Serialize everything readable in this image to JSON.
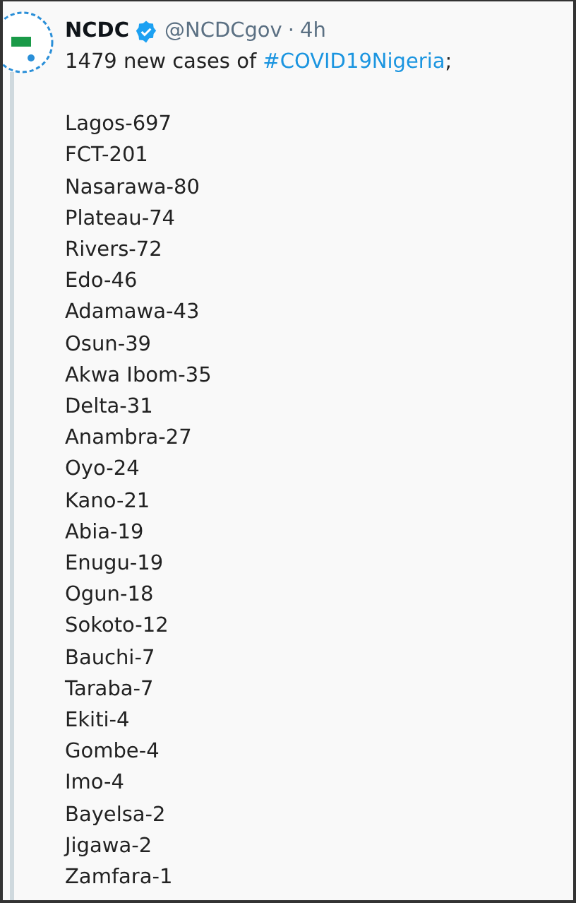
{
  "tweet": {
    "name": "NCDC",
    "handle": "@NCDCgov",
    "separator": "·",
    "time": "4h",
    "verified": true,
    "intro": "1479 new cases of ",
    "hashtag": "#COVID19Nigeria",
    "intro_end": ";",
    "lines": [
      "Lagos-697",
      "FCT-201",
      "Nasarawa-80",
      "Plateau-74",
      "Rivers-72",
      "Edo-46",
      "Adamawa-43",
      "Osun-39",
      "Akwa Ibom-35",
      "Delta-31",
      "Anambra-27",
      "Oyo-24",
      "Kano-21",
      "Abia-19",
      "Enugu-19",
      "Ogun-18",
      "Sokoto-12",
      "Bauchi-7",
      "Taraba-7",
      "Ekiti-4",
      "Gombe-4",
      "Imo-4",
      "Bayelsa-2",
      "Jigawa-2",
      "Zamfara-1"
    ]
  }
}
